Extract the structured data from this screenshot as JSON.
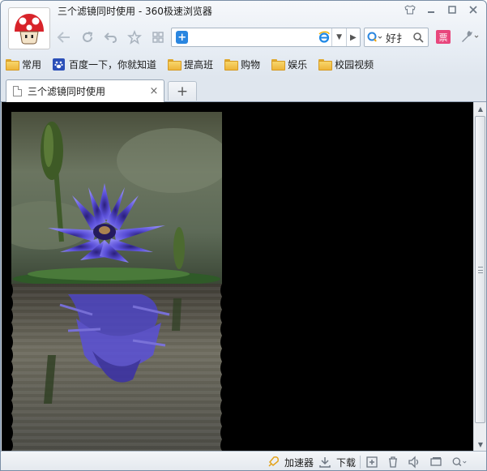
{
  "window": {
    "title": "三个滤镜同时使用 - 360极速浏览器",
    "minimize_label": "–",
    "maximize_label": "□",
    "close_label": "✕"
  },
  "address_bar": {
    "value": "",
    "placeholder": ""
  },
  "search": {
    "value": "好扌"
  },
  "ticket_button": {
    "label": "票"
  },
  "bookmarks": [
    {
      "label": "常用",
      "icon": "folder-icon"
    },
    {
      "label": "百度一下，你就知道",
      "icon": "baidu-paw-icon"
    },
    {
      "label": "提高班",
      "icon": "folder-icon"
    },
    {
      "label": "购物",
      "icon": "folder-icon"
    },
    {
      "label": "娱乐",
      "icon": "folder-icon"
    },
    {
      "label": "校园视频",
      "icon": "folder-icon"
    }
  ],
  "tabs": [
    {
      "label": "三个滤镜同时使用",
      "active": true
    }
  ],
  "new_tab_label": "+",
  "tab_close_label": "×",
  "statusbar": {
    "accelerator_label": "加速器",
    "download_label": "下载"
  },
  "colors": {
    "page_background": "#000000",
    "accent": "#2a86e0",
    "ticket": "#e8467c"
  }
}
